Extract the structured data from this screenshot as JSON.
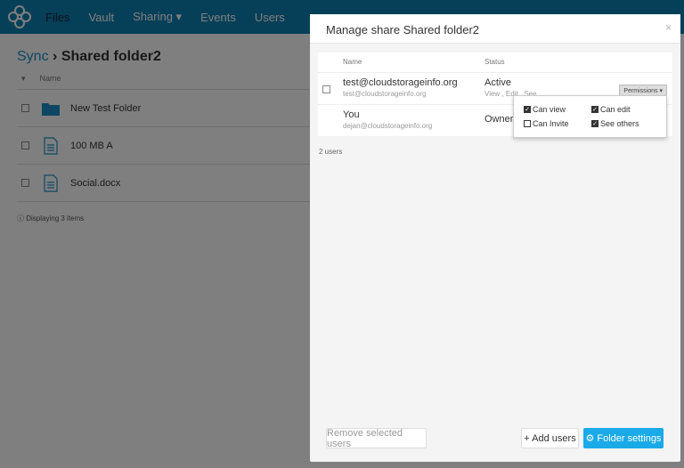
{
  "nav": {
    "items": [
      "Files",
      "Vault",
      "Sharing ▾",
      "Events",
      "Users"
    ]
  },
  "breadcrumb": {
    "root": "Sync",
    "separator": "›",
    "current": "Shared folder2"
  },
  "files": {
    "header": "Name",
    "rows": [
      {
        "name": "New Test Folder",
        "icon": "folder-icon"
      },
      {
        "name": "100 MB A",
        "icon": "file-icon"
      },
      {
        "name": "Social.docx",
        "icon": "file-icon"
      }
    ],
    "status": "Displaying 3 items"
  },
  "modal": {
    "title": "Manage share Shared folder2",
    "close": "×",
    "headers": {
      "name": "Name",
      "status": "Status"
    },
    "users": [
      {
        "name": "test@cloudstorageinfo.org",
        "email": "test@cloudstorageinfo.org",
        "status": "Active",
        "perms": "View , Edit , See"
      },
      {
        "name": "You",
        "email": "dejan@cloudstorageinfo.org",
        "status": "Owner"
      }
    ],
    "permissions_button": "Permissions ▾",
    "options": [
      {
        "label": "Can view",
        "checked": true
      },
      {
        "label": "Can edit",
        "checked": true
      },
      {
        "label": "Can Invite",
        "checked": false
      },
      {
        "label": "See others",
        "checked": true
      }
    ],
    "count": "2 users",
    "remove": "Remove selected users",
    "add": "+ Add users",
    "settings": "Folder settings"
  },
  "colors": {
    "nav": "#0d7fb0",
    "primary": "#1aaae8"
  }
}
